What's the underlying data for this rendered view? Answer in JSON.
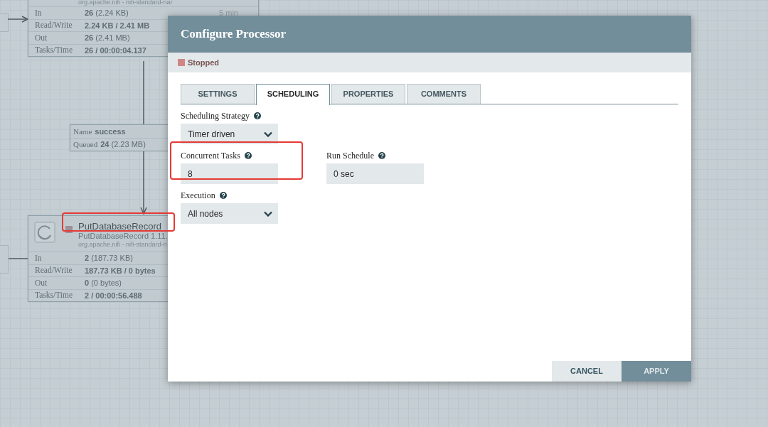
{
  "canvas": {
    "processors": [
      {
        "bundle": "org.apache.nifi - nifi-standard-nar",
        "extra": "5 min",
        "stats": [
          {
            "label": "In",
            "value": "**26** (2.24 KB)"
          },
          {
            "label": "Read/Write",
            "value": "**2.24 KB / 2.41 MB**"
          },
          {
            "label": "Out",
            "value": "**26** (2.41 MB)"
          },
          {
            "label": "Tasks/Time",
            "value": "**26 / 00:00:04.137**"
          }
        ]
      },
      {
        "name": "PutDatabaseRecord",
        "type": "PutDatabaseRecord 1.11.",
        "bundle": "org.apache.nifi - nifi-standard-n",
        "stopped": true,
        "stats": [
          {
            "label": "In",
            "value": "**2** (187.73 KB)"
          },
          {
            "label": "Read/Write",
            "value": "**187.73 KB / 0 bytes**"
          },
          {
            "label": "Out",
            "value": "**0** (0 bytes)"
          },
          {
            "label": "Tasks/Time",
            "value": "**2 / 00:00:56.488**"
          }
        ]
      }
    ],
    "connection": {
      "name_label": "Name",
      "name": "success",
      "queued_label": "Queued",
      "queued": "**24** (2.23 MB)"
    }
  },
  "dialog": {
    "title": "Configure Processor",
    "status": {
      "stopped": true,
      "label": "Stopped"
    },
    "tabs": [
      {
        "label": "SETTINGS",
        "selected": false
      },
      {
        "label": "SCHEDULING",
        "selected": true
      },
      {
        "label": "PROPERTIES",
        "selected": false
      },
      {
        "label": "COMMENTS",
        "selected": false
      }
    ],
    "field_rows": [
      [
        {
          "label": "Scheduling Strategy",
          "kind": "select",
          "value": "Timer driven",
          "highlighted": false
        }
      ],
      [
        {
          "label": "Concurrent Tasks",
          "kind": "text",
          "value": "8",
          "highlighted": true
        },
        {
          "label": "Run Schedule",
          "kind": "text",
          "value": "0 sec",
          "highlighted": false
        }
      ],
      [
        {
          "label": "Execution",
          "kind": "select",
          "value": "All nodes",
          "highlighted": false
        }
      ]
    ],
    "buttons": [
      {
        "label": "CANCEL",
        "kind": "secondary"
      },
      {
        "label": "APPLY",
        "kind": "primary"
      }
    ]
  }
}
